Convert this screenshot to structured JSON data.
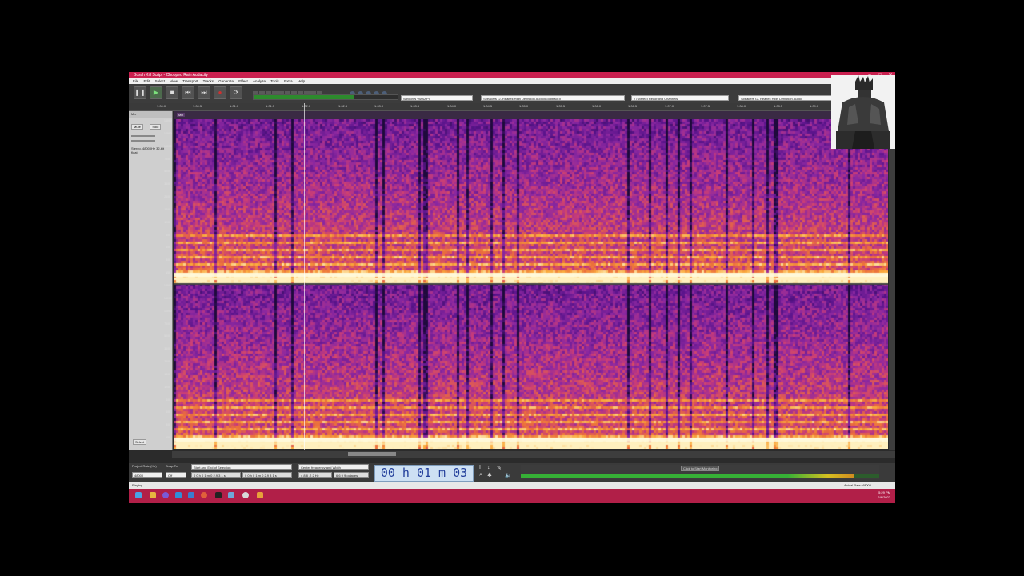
{
  "window": {
    "title": "Bosch Kill Script - Chopped Rain Audacity"
  },
  "menubar": {
    "items": [
      "File",
      "Edit",
      "Select",
      "View",
      "Transport",
      "Tracks",
      "Generate",
      "Effect",
      "Analyze",
      "Tools",
      "Extra",
      "Help"
    ]
  },
  "toolbar": {
    "host_label": "Windows WASAPI",
    "recording_device": "Speakers (2- Realtek High Definition Audio(Loopback))",
    "channels": "2 (Stereo) Recording Channels",
    "playback_device": "Speakers (2- Realtek High Definition Audio)"
  },
  "timeline": {
    "ticks": [
      "1:00.0",
      "1:00.5",
      "1:01.0",
      "1:01.5",
      "1:02.0",
      "1:02.5",
      "1:03.0",
      "1:03.5",
      "1:04.0",
      "1:04.5",
      "1:05.0",
      "1:05.5",
      "1:06.0",
      "1:06.5",
      "1:07.0",
      "1:07.5",
      "1:08.0",
      "1:08.5",
      "1:09.0",
      "1:09.5",
      "1:10.0"
    ]
  },
  "track": {
    "name": "Mix",
    "mute_label": "Mute",
    "solo_label": "Solo",
    "info": "Stereo, 48000Hz 32-bit float",
    "select_label": "Select",
    "clip_name": "Mix"
  },
  "frequency_scale": [
    "18000",
    "14000",
    "10000",
    "7000",
    "5000",
    "3500",
    "2500",
    "1800",
    "1200",
    "800",
    "500",
    "300",
    "150"
  ],
  "bottombar": {
    "project_rate_label": "Project Rate (Hz)",
    "project_rate": "48000",
    "snap_to_label": "Snap-To",
    "snap_to": "Off",
    "selection_label": "Start and End of Selection",
    "selection_start": "0 0 h 0 1 m 0 2.9 3 1 s",
    "selection_end": "0 0 h 0 1 m 0 2.9 3 1 s",
    "spectral_label": "Center frequency and Width",
    "center_freq": "4 8 8 .2 2 Hz",
    "width": "6.6 9 9 octaves",
    "audio_position": "00 h 01 m 03 s"
  },
  "meter": {
    "click_to_start": "Click to Start Monitoring",
    "level_percent": 93
  },
  "status": {
    "left": "Playing.",
    "right": "Actual Rate: 48000"
  },
  "clock": {
    "time": "5:29 PM",
    "date": "6/6/2022"
  }
}
